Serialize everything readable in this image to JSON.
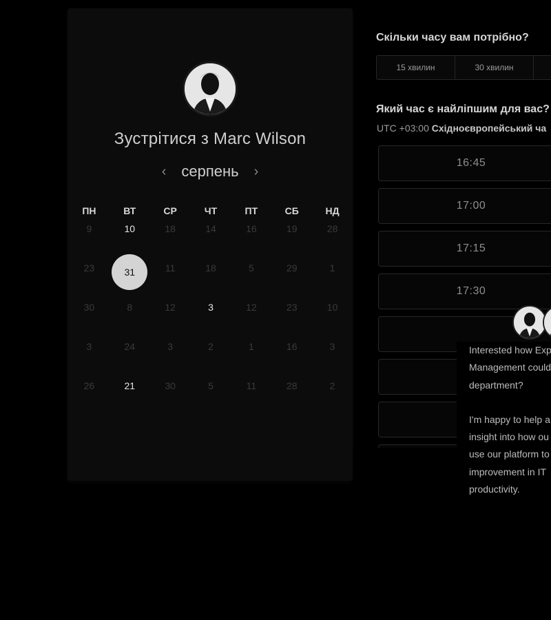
{
  "calendar": {
    "title": "Зустрітися з Marc Wilson",
    "month": "серпень",
    "prev_icon": "chevron-left-icon",
    "next_icon": "chevron-right-icon",
    "weekdays": [
      "ПН",
      "ВТ",
      "СР",
      "ЧТ",
      "ПТ",
      "СБ",
      "НД"
    ],
    "rows": [
      [
        {
          "d": "9",
          "a": false
        },
        {
          "d": "10",
          "a": true
        },
        {
          "d": "18",
          "a": false
        },
        {
          "d": "14",
          "a": false
        },
        {
          "d": "16",
          "a": false
        },
        {
          "d": "19",
          "a": false
        },
        {
          "d": "28",
          "a": false
        }
      ],
      [
        {
          "d": "23",
          "a": false
        },
        {
          "d": "31",
          "a": true,
          "sel": true
        },
        {
          "d": "11",
          "a": false
        },
        {
          "d": "18",
          "a": false
        },
        {
          "d": "5",
          "a": false
        },
        {
          "d": "29",
          "a": false
        },
        {
          "d": "1",
          "a": false
        }
      ],
      [
        {
          "d": "30",
          "a": false
        },
        {
          "d": "8",
          "a": false
        },
        {
          "d": "12",
          "a": false
        },
        {
          "d": "3",
          "a": true
        },
        {
          "d": "12",
          "a": false
        },
        {
          "d": "23",
          "a": false
        },
        {
          "d": "10",
          "a": false
        }
      ],
      [
        {
          "d": "3",
          "a": false
        },
        {
          "d": "24",
          "a": false
        },
        {
          "d": "3",
          "a": false
        },
        {
          "d": "2",
          "a": false
        },
        {
          "d": "1",
          "a": false
        },
        {
          "d": "16",
          "a": false
        },
        {
          "d": "3",
          "a": false
        }
      ],
      [
        {
          "d": "26",
          "a": false
        },
        {
          "d": "21",
          "a": true
        },
        {
          "d": "30",
          "a": false
        },
        {
          "d": "5",
          "a": false
        },
        {
          "d": "11",
          "a": false
        },
        {
          "d": "28",
          "a": false
        },
        {
          "d": "2",
          "a": false
        }
      ]
    ]
  },
  "duration": {
    "question": "Скільки часу вам потрібно?",
    "options": [
      "15 хвилин",
      "30 хвилин"
    ]
  },
  "time": {
    "question": "Який час є найліпшим для вас?",
    "tz_offset": "UTC +03:00",
    "tz_name": "Східноєвропейський ча",
    "slots": [
      "16:45",
      "17:00",
      "17:15",
      "17:30",
      "",
      "",
      "",
      ""
    ]
  },
  "chat": {
    "lines_a": [
      "Interested how Exp",
      "Management could",
      "department?"
    ],
    "lines_b": [
      "I'm happy to help a",
      "insight into how ou",
      "use our platform to",
      "improvement in IT",
      "productivity."
    ]
  },
  "colors": {
    "background": "#000000",
    "card": "#0c0c0c",
    "selected_day": "#d4d4d4"
  }
}
